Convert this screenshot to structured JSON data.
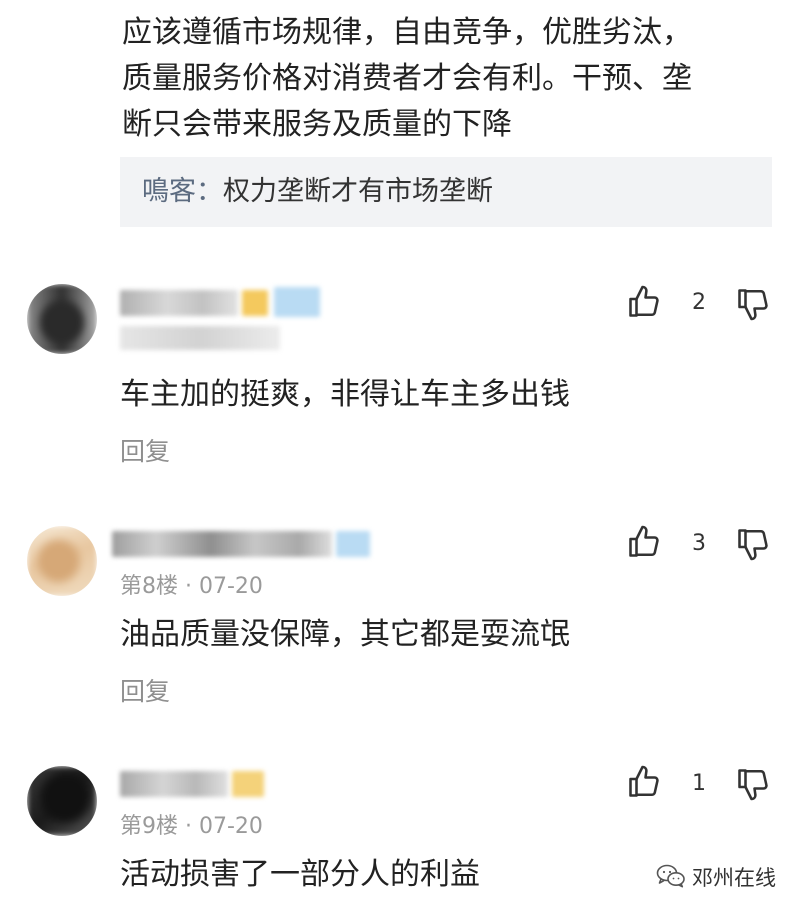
{
  "top_comment": {
    "lines": [
      "应该遵循市场规律，自由竞争，优胜劣汰，",
      "质量服务价格对消费者才会有利。干预、垄",
      "断只会带来服务及质量的下降"
    ],
    "quote": {
      "author": "鳴客：",
      "text": "权力垄断才有市场垄断"
    }
  },
  "comments": [
    {
      "text": "车主加的挺爽，非得让车主多出钱",
      "likes": "2",
      "reply_label": "回复"
    },
    {
      "floor": "第8楼",
      "dot": "·",
      "date": "07-20",
      "text": "油品质量没保障，其它都是耍流氓",
      "likes": "3",
      "reply_label": "回复"
    },
    {
      "floor": "第9楼",
      "dot": "·",
      "date": "07-20",
      "text": "活动损害了一部分人的利益",
      "likes": "1"
    }
  ],
  "watermark": {
    "text": "邓州在线"
  },
  "colors": {
    "text": "#222222",
    "secondary": "#9a9a9a",
    "quote_bg": "#f2f3f5",
    "quote_author": "#5c6b80"
  },
  "icons": [
    "thumbs-up-icon",
    "thumbs-down-icon",
    "wechat-icon"
  ]
}
